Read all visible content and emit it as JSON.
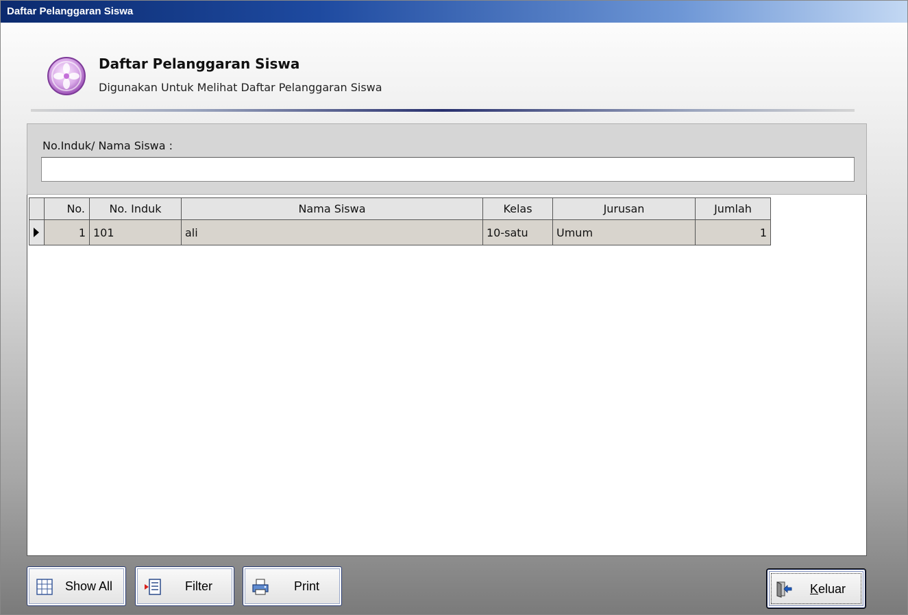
{
  "window": {
    "title": "Daftar Pelanggaran Siswa"
  },
  "header": {
    "icon": "flower-app-icon",
    "title": "Daftar Pelanggaran Siswa",
    "subtitle": "Digunakan Untuk Melihat Daftar Pelanggaran Siswa"
  },
  "search": {
    "label": "No.Induk/ Nama Siswa :",
    "value": "",
    "placeholder": ""
  },
  "grid": {
    "columns": [
      "No.",
      "No. Induk",
      "Nama Siswa",
      "Kelas",
      "Jurusan",
      "Jumlah"
    ],
    "rows": [
      {
        "no": "1",
        "no_induk": "101",
        "nama": "ali",
        "kelas": "10-satu",
        "jurusan": "Umum",
        "jumlah": "1",
        "selected": true
      }
    ]
  },
  "buttons": {
    "show_all": {
      "label": "Show All",
      "icon": "table-grid-icon"
    },
    "filter": {
      "label": "Filter",
      "icon": "filter-list-icon"
    },
    "print": {
      "label": "Print",
      "icon": "printer-icon"
    },
    "keluar": {
      "label_underlined": "K",
      "label_rest": "eluar",
      "icon": "exit-door-icon"
    }
  },
  "colors": {
    "titlebar_start": "#0b2a6e",
    "titlebar_end": "#c3d8f3",
    "grid_row": "#d8d4cd",
    "accent_border": "#2b3d74"
  }
}
